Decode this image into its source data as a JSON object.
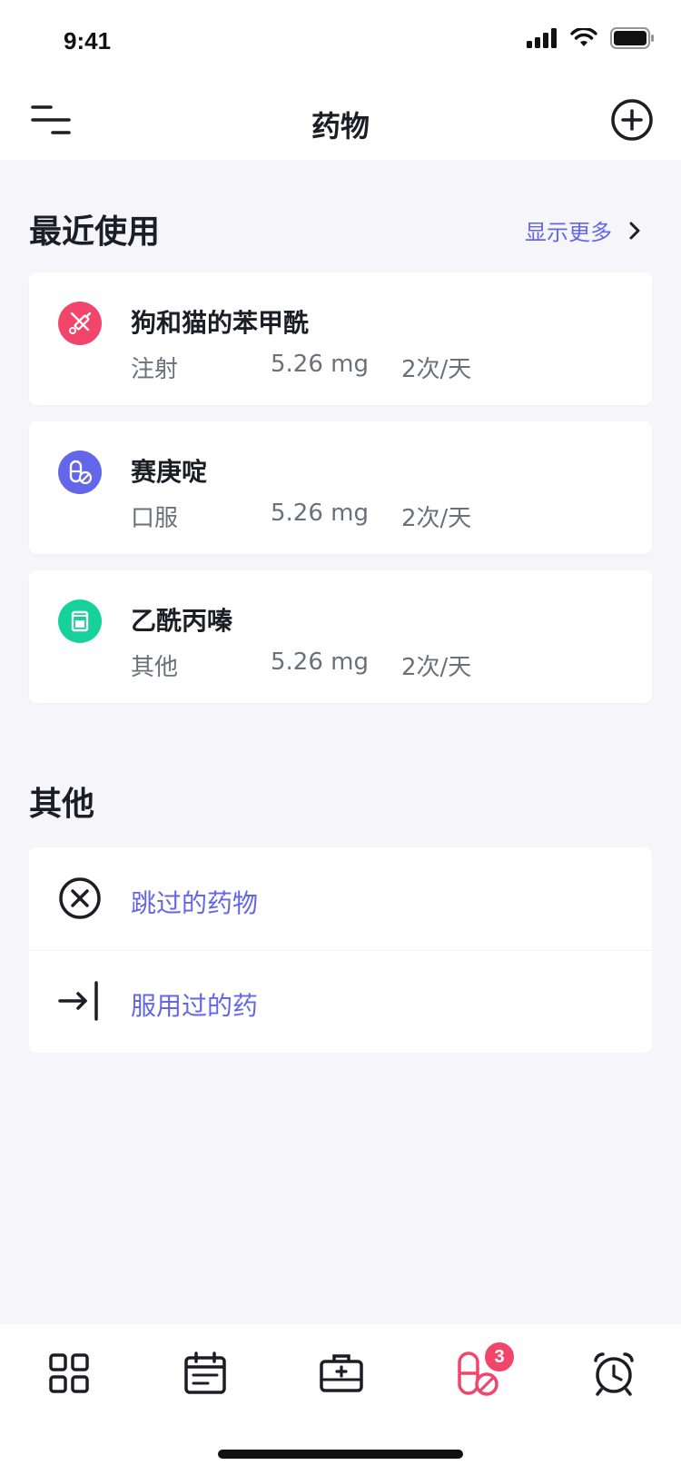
{
  "status_bar": {
    "time": "9:41"
  },
  "nav": {
    "title": "药物"
  },
  "recent": {
    "title": "最近使用",
    "show_more": "显示更多",
    "items": [
      {
        "name": "狗和猫的苯甲酰",
        "route": "注射",
        "dose": "5.26 mg",
        "frequency": "2次/天",
        "icon": "syringe-icon",
        "color": "#F2456B"
      },
      {
        "name": "赛庚啶",
        "route": "口服",
        "dose": "5.26 mg",
        "frequency": "2次/天",
        "icon": "pill-icon",
        "color": "#6466E9"
      },
      {
        "name": "乙酰丙嗪",
        "route": "其他",
        "dose": "5.26 mg",
        "frequency": "2次/天",
        "icon": "medicine-cup-icon",
        "color": "#16D29A"
      }
    ]
  },
  "other": {
    "title": "其他",
    "items": [
      {
        "label": "跳过的药物",
        "icon": "skip-circle-icon"
      },
      {
        "label": "服用过的药",
        "icon": "taken-arrow-icon"
      }
    ]
  },
  "tabbar": {
    "tabs": [
      {
        "name": "dashboard",
        "icon": "grid-icon"
      },
      {
        "name": "calendar",
        "icon": "calendar-icon"
      },
      {
        "name": "first-aid",
        "icon": "medical-kit-icon"
      },
      {
        "name": "medications",
        "icon": "pill-tab-icon",
        "active": true,
        "badge": "3"
      },
      {
        "name": "reminders",
        "icon": "alarm-clock-icon"
      }
    ],
    "active_color": "#F2456B"
  }
}
